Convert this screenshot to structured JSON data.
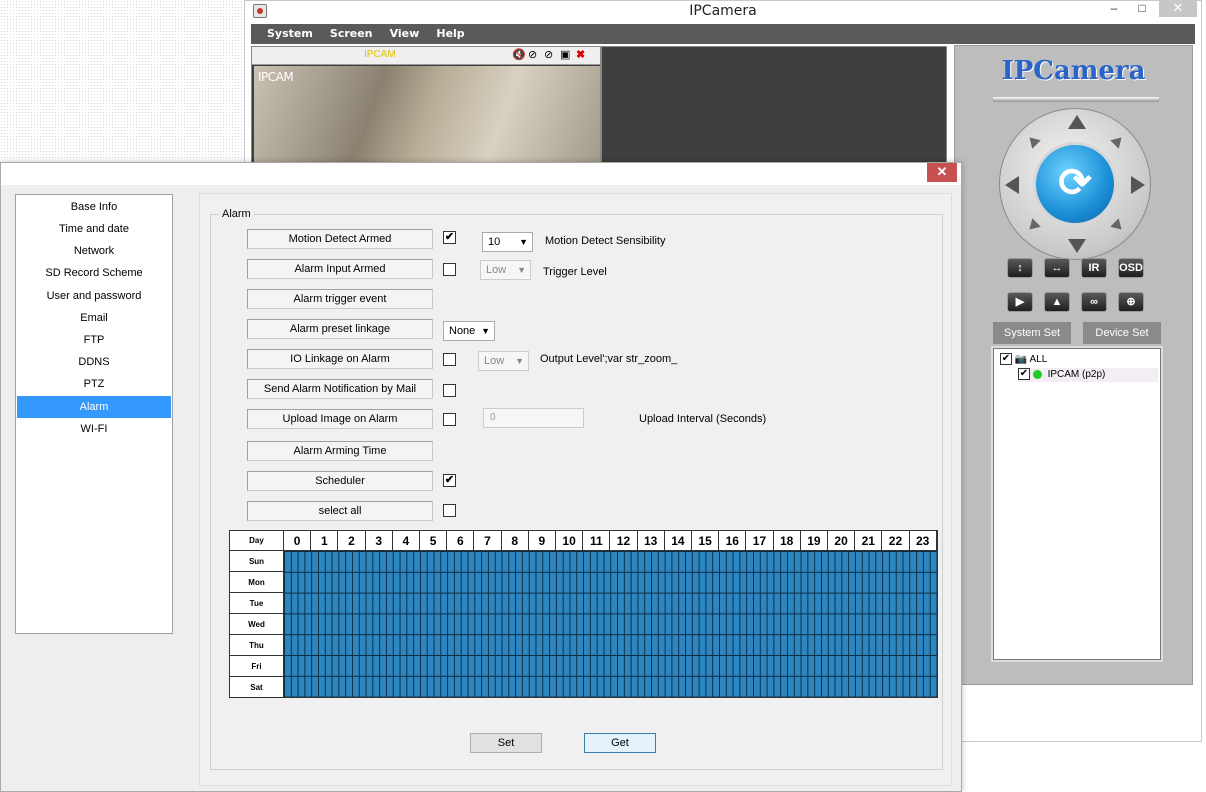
{
  "window": {
    "title": "IPCamera",
    "minimize": "–",
    "maximize": "□",
    "close": "✕"
  },
  "menu": [
    "System",
    "Screen",
    "View",
    "Help"
  ],
  "video": {
    "header_label": "IPCAM",
    "overlay_label": "IPCAM",
    "header_icons": [
      "mute-icon",
      "record-off-icon",
      "talk-off-icon",
      "snapshot-icon",
      "close-icon"
    ]
  },
  "ptz": {
    "brand": "IPCamera",
    "buttons_row1": [
      "↕",
      "↔",
      "IR",
      "OSD"
    ],
    "buttons_row2": [
      "▶",
      "▲",
      "∞",
      "⊕"
    ],
    "tabs": [
      "System Set",
      "Device Set"
    ],
    "tree": {
      "root": "ALL",
      "device": "IPCAM (p2p)",
      "device_status_color": "#22cc22"
    }
  },
  "dialog": {
    "close": "✕",
    "nav": [
      "Base Info",
      "Time and date",
      "Network",
      "SD Record Scheme",
      "User and password",
      "Email",
      "FTP",
      "DDNS",
      "PTZ",
      "Alarm",
      "WI-FI"
    ],
    "active_nav": "Alarm",
    "group_label": "Alarm",
    "rows": {
      "motion_detect_armed": "Motion Detect Armed",
      "alarm_input_armed": "Alarm Input Armed",
      "alarm_trigger_event": "Alarm trigger event",
      "alarm_preset_linkage": "Alarm preset linkage",
      "io_linkage": "IO Linkage on Alarm",
      "send_mail": "Send Alarm Notification by Mail",
      "upload_image": "Upload Image on Alarm",
      "arming_time": "Alarm Arming Time",
      "scheduler": "Scheduler",
      "select_all": "select all"
    },
    "motion_sensibility_value": "10",
    "motion_sensibility_label": "Motion Detect Sensibility",
    "trigger_level_value": "Low",
    "trigger_level_label": "Trigger Level",
    "preset_value": "None",
    "output_level_value": "Low",
    "output_level_label": "Output Level';var str_zoom_",
    "upload_interval_value": "0",
    "upload_interval_label": "Upload Interval (Seconds)",
    "checks": {
      "motion_detect_armed": "✔",
      "alarm_input_armed": "",
      "io_linkage": "",
      "send_mail": "",
      "upload_image": "",
      "scheduler": "✔",
      "select_all": ""
    },
    "schedule": {
      "day_header": "Day",
      "hours": [
        "0",
        "1",
        "2",
        "3",
        "4",
        "5",
        "6",
        "7",
        "8",
        "9",
        "10",
        "11",
        "12",
        "13",
        "14",
        "15",
        "16",
        "17",
        "18",
        "19",
        "20",
        "21",
        "22",
        "23"
      ],
      "days": [
        "Sun",
        "Mon",
        "Tue",
        "Wed",
        "Thu",
        "Fri",
        "Sat"
      ],
      "fill_color": "#2e86c1",
      "all_selected": true
    },
    "set_label": "Set",
    "get_label": "Get"
  }
}
